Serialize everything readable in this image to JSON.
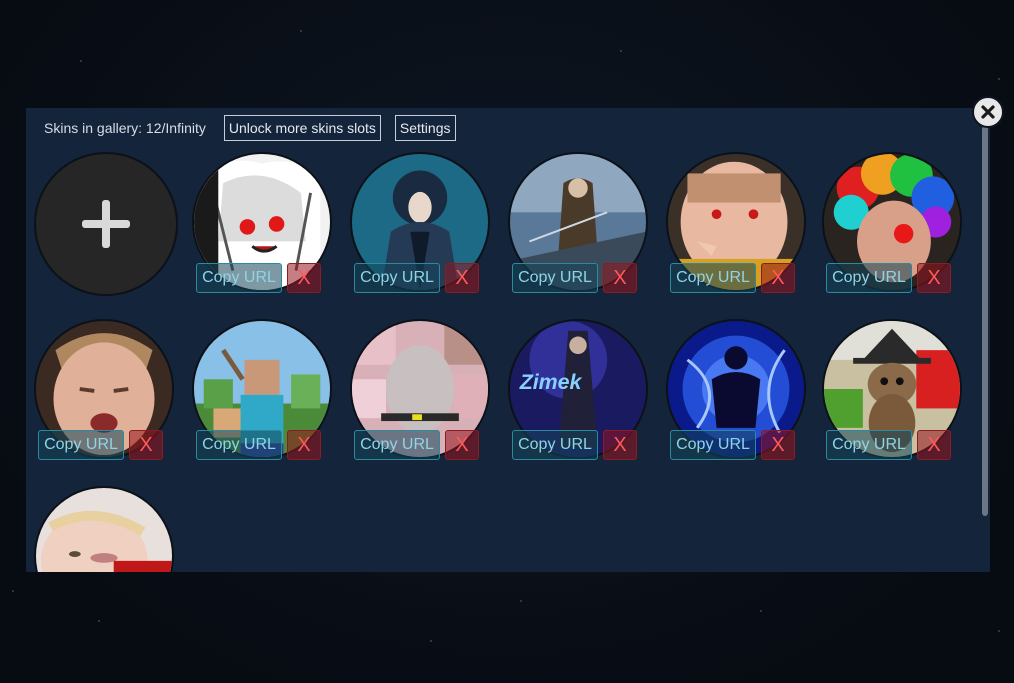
{
  "gallery": {
    "count_text": "Skins in gallery: 12/Infinity",
    "unlock_label": "Unlock more skins slots",
    "settings_label": "Settings",
    "close_icon": "close-icon",
    "add_icon": "plus-icon"
  },
  "tiles": [
    {
      "copy_label": "Copy URL",
      "delete_label": "X",
      "theme": "anime-white-hair"
    },
    {
      "copy_label": "Copy URL",
      "delete_label": "X",
      "theme": "anime-dark-hood"
    },
    {
      "copy_label": "Copy URL",
      "delete_label": "X",
      "theme": "anime-soldier"
    },
    {
      "copy_label": "Copy URL",
      "delete_label": "X",
      "theme": "face-red-eyes"
    },
    {
      "copy_label": "Copy URL",
      "delete_label": "X",
      "theme": "clown-rainbow-wig"
    },
    {
      "copy_label": "Copy URL",
      "delete_label": "X",
      "theme": "face-closeup"
    },
    {
      "copy_label": "Copy URL",
      "delete_label": "X",
      "theme": "minecraft-character"
    },
    {
      "copy_label": "Copy URL",
      "delete_label": "X",
      "theme": "face-collage"
    },
    {
      "copy_label": "Copy URL",
      "delete_label": "X",
      "theme": "anime-purple-text"
    },
    {
      "copy_label": "Copy URL",
      "delete_label": "X",
      "theme": "blue-energy-silhouette"
    },
    {
      "copy_label": "Copy URL",
      "delete_label": "X",
      "theme": "kitten-witch-hat"
    },
    {
      "copy_label": "",
      "delete_label": "",
      "theme": "face-pale"
    }
  ]
}
